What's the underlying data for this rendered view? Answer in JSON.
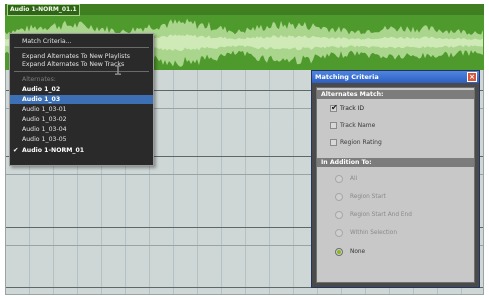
{
  "region": {
    "name": "Audio 1-NORM_01.1",
    "colors": {
      "body": "#4f9a2c",
      "wave": "#a9d58c",
      "wave_core": "#cfeab7"
    }
  },
  "popup_menu": {
    "items": [
      {
        "label": "Match Criteria...",
        "kind": "normal"
      },
      {
        "kind": "separator"
      },
      {
        "label": "Expand Alternates To New Playlists",
        "kind": "normal"
      },
      {
        "label": "Expand Alternates To New Tracks",
        "kind": "normal"
      },
      {
        "kind": "separator"
      },
      {
        "label": "Alternates:",
        "kind": "disabled"
      },
      {
        "label": "Audio 1_02",
        "kind": "bold"
      },
      {
        "label": "Audio 1_03",
        "kind": "bold",
        "highlighted": true
      },
      {
        "label": "Audio 1_03-01",
        "kind": "normal"
      },
      {
        "label": "Audio 1_03-02",
        "kind": "normal"
      },
      {
        "label": "Audio 1_03-04",
        "kind": "normal"
      },
      {
        "label": "Audio 1_03-05",
        "kind": "normal"
      },
      {
        "label": "Audio 1-NORM_01",
        "kind": "bold",
        "checked": true
      }
    ],
    "check_mark": "✔"
  },
  "dialog": {
    "title": "Matching Criteria",
    "close_icon": "×",
    "alternates_match": {
      "header": "Alternates Match:",
      "options": [
        {
          "label": "Track ID",
          "checked": true
        },
        {
          "label": "Track Name",
          "checked": false
        },
        {
          "label": "Region Rating",
          "checked": false
        }
      ],
      "tick": "✔"
    },
    "in_addition_to": {
      "header": "In Addition To:",
      "options": [
        {
          "label": "All",
          "selected": false
        },
        {
          "label": "Region Start",
          "selected": false
        },
        {
          "label": "Region Start And End",
          "selected": false
        },
        {
          "label": "Within Selection",
          "selected": false
        },
        {
          "label": "None",
          "selected": true
        }
      ]
    }
  },
  "colors": {
    "menu_bg": "#2a2a2a",
    "menu_highlight": "#3c6fb3",
    "titlebar": "#2d5fc0",
    "close_button": "#d6563a",
    "radio_selected": "#88b91a"
  }
}
